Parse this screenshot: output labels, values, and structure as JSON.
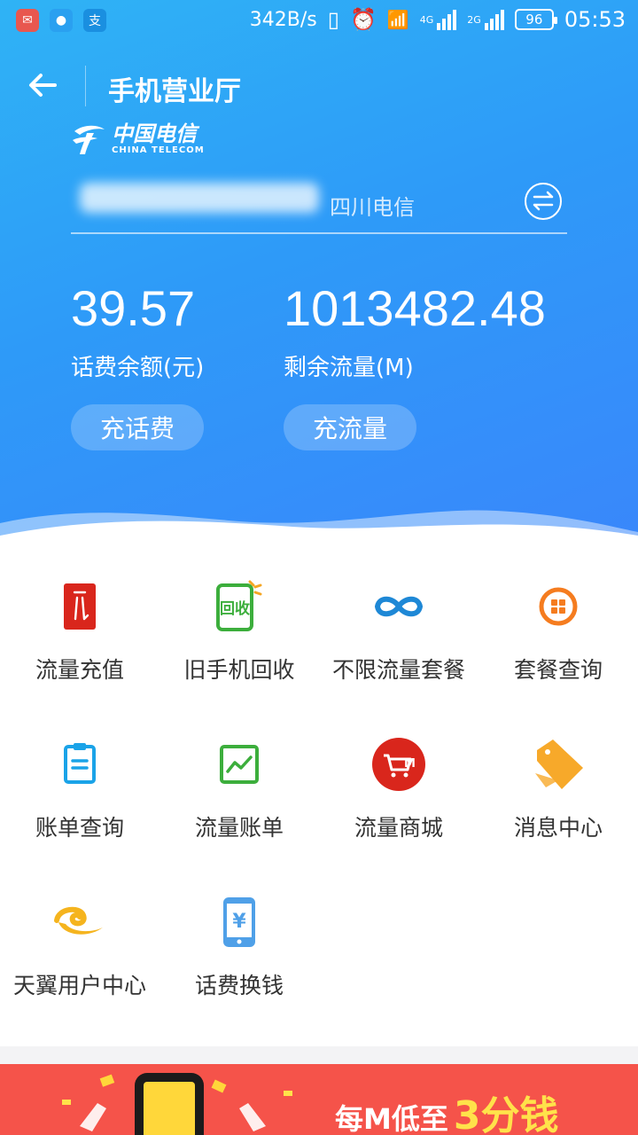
{
  "status_bar": {
    "net_speed": "342B/s",
    "battery": "96",
    "time": "05:53",
    "signal1_tags": [
      "4G",
      "2G"
    ],
    "signal2_tag": "2G",
    "left_apps": [
      "mail-app-icon",
      "message-app-icon",
      "alipay-app-icon"
    ],
    "alipay_glyph": "支"
  },
  "header": {
    "title": "手机营业厅"
  },
  "brand": {
    "name_cn": "中国电信",
    "name_en": "CHINA TELECOM"
  },
  "account": {
    "carrier": "四川电信"
  },
  "balances": {
    "fee_value": "39.57",
    "fee_label": "话费余额(元)",
    "data_value": "1013482.48",
    "data_label": "剩余流量(M)"
  },
  "actions": {
    "recharge_fee": "充话费",
    "recharge_data": "充流量"
  },
  "services": [
    {
      "label": "流量充值",
      "icon": "data-recharge-icon",
      "color": "#d9261c"
    },
    {
      "label": "旧手机回收",
      "icon": "phone-recycle-icon",
      "color": "#3cae3c",
      "icon_text": "回收"
    },
    {
      "label": "不限流量套餐",
      "icon": "infinity-icon",
      "color": "#1e88d6"
    },
    {
      "label": "套餐查询",
      "icon": "package-query-icon",
      "color": "#f57c1f"
    },
    {
      "label": "账单查询",
      "icon": "bill-icon",
      "color": "#1aa3e8"
    },
    {
      "label": "流量账单",
      "icon": "data-chart-icon",
      "color": "#3cae3c"
    },
    {
      "label": "流量商城",
      "icon": "data-mall-icon",
      "color": "#d9261c"
    },
    {
      "label": "消息中心",
      "icon": "tag-icon",
      "color": "#f7a92a"
    },
    {
      "label": "天翼用户中心",
      "icon": "tianyi-logo-icon",
      "color": "#f5b41e"
    },
    {
      "label": "话费换钱",
      "icon": "phone-money-icon",
      "color": "#4fa0e8",
      "icon_text": "¥"
    }
  ],
  "banner": {
    "text": "每M低至",
    "highlight": "3分钱"
  }
}
